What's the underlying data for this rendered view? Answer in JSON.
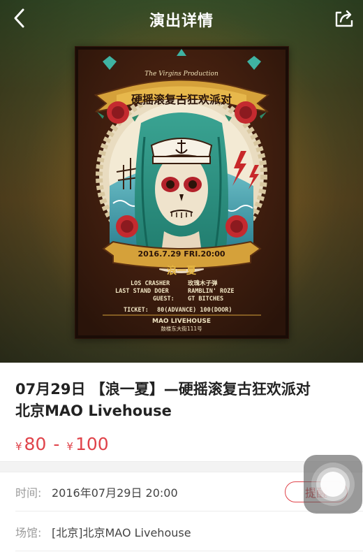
{
  "nav": {
    "title": "演出详情",
    "back_icon": "chevron-left-icon",
    "share_icon": "share-icon"
  },
  "poster": {
    "producer": "The Virgins Production",
    "banner_title": "硬摇滚复古狂欢派对",
    "date_banner": "2016.7.29 FRI.20:00",
    "subtitle": "浪一夏",
    "lineup_left_1": "LOS CRASHER",
    "lineup_right_1": "玫瑰木子弹",
    "lineup_left_2": "LAST STAND DOER",
    "lineup_right_2": "RAMBLIN' ROZE",
    "guest_label": "GUEST:",
    "guest_value": "GT BITCHES",
    "ticket_label": "TICKET:",
    "ticket_value": "80(ADVANCE) 100(DOOR)",
    "venue_name": "MAO LIVEHOUSE",
    "venue_address": "鼓楼东大街111号"
  },
  "event": {
    "title_line1": "07月29日 【浪一夏】—硬摇滚复古狂欢派对",
    "title_line2": "北京MAO Livehouse",
    "price_currency": "¥",
    "price_low": "80",
    "price_sep": "-",
    "price_high": "100",
    "price_color": "#e0434a"
  },
  "details": {
    "time_label": "时间:",
    "time_value": "2016年07月29日 20:00",
    "remind_label": "提醒",
    "venue_label": "场馆:",
    "venue_value": "[北京]北京MAO Livehouse"
  }
}
